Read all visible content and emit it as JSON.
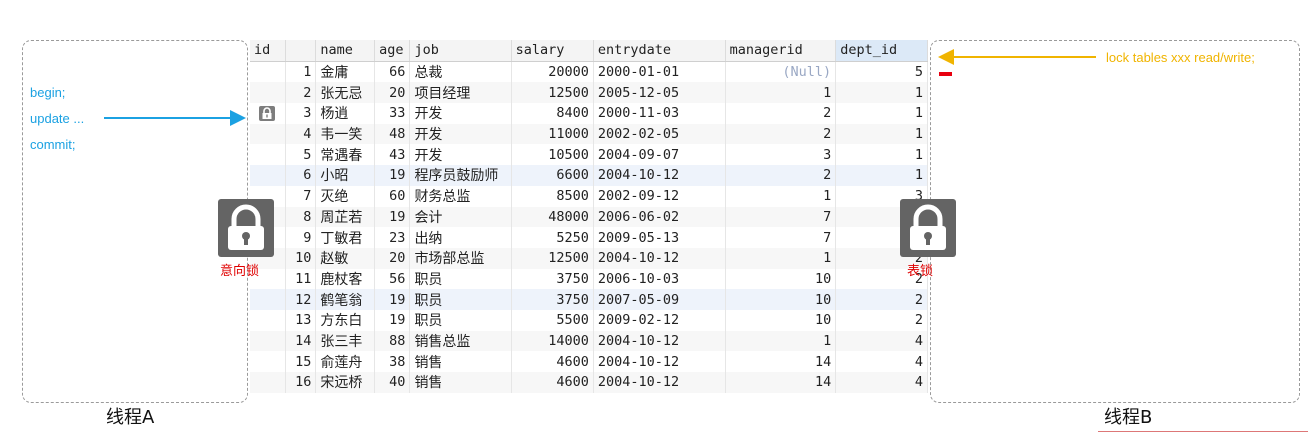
{
  "threadA": {
    "label": "线程A",
    "statements": [
      "begin;",
      "update ...",
      "commit;"
    ]
  },
  "threadB": {
    "label": "线程B",
    "command": "lock tables xxx read/write;"
  },
  "locks": {
    "intent_label": "意向锁",
    "table_label": "表锁"
  },
  "colors": {
    "threadA_text": "#1ba1e2",
    "threadB_text": "#f0b400",
    "lock_label": "#e00000",
    "lock_body": "#646464"
  },
  "table": {
    "columns": [
      "id",
      "name",
      "age",
      "job",
      "salary",
      "entrydate",
      "managerid",
      "dept_id"
    ],
    "rows": [
      [
        "1",
        "金庸",
        "66",
        "总裁",
        "20000",
        "2000-01-01",
        "(Null)",
        "5"
      ],
      [
        "2",
        "张无忌",
        "20",
        "项目经理",
        "12500",
        "2005-12-05",
        "1",
        "1"
      ],
      [
        "3",
        "杨逍",
        "33",
        "开发",
        "8400",
        "2000-11-03",
        "2",
        "1"
      ],
      [
        "4",
        "韦一笑",
        "48",
        "开发",
        "11000",
        "2002-02-05",
        "2",
        "1"
      ],
      [
        "5",
        "常遇春",
        "43",
        "开发",
        "10500",
        "2004-09-07",
        "3",
        "1"
      ],
      [
        "6",
        "小昭",
        "19",
        "程序员鼓励师",
        "6600",
        "2004-10-12",
        "2",
        "1"
      ],
      [
        "7",
        "灭绝",
        "60",
        "财务总监",
        "8500",
        "2002-09-12",
        "1",
        "3"
      ],
      [
        "8",
        "周芷若",
        "19",
        "会计",
        "48000",
        "2006-06-02",
        "7",
        "3"
      ],
      [
        "9",
        "丁敏君",
        "23",
        "出纳",
        "5250",
        "2009-05-13",
        "7",
        "3"
      ],
      [
        "10",
        "赵敏",
        "20",
        "市场部总监",
        "12500",
        "2004-10-12",
        "1",
        "2"
      ],
      [
        "11",
        "鹿杖客",
        "56",
        "职员",
        "3750",
        "2006-10-03",
        "10",
        "2"
      ],
      [
        "12",
        "鹤笔翁",
        "19",
        "职员",
        "3750",
        "2007-05-09",
        "10",
        "2"
      ],
      [
        "13",
        "方东白",
        "19",
        "职员",
        "5500",
        "2009-02-12",
        "10",
        "2"
      ],
      [
        "14",
        "张三丰",
        "88",
        "销售总监",
        "14000",
        "2004-10-12",
        "1",
        "4"
      ],
      [
        "15",
        "俞莲舟",
        "38",
        "销售",
        "4600",
        "2004-10-12",
        "14",
        "4"
      ],
      [
        "16",
        "宋远桥",
        "40",
        "销售",
        "4600",
        "2004-10-12",
        "14",
        "4"
      ]
    ]
  }
}
